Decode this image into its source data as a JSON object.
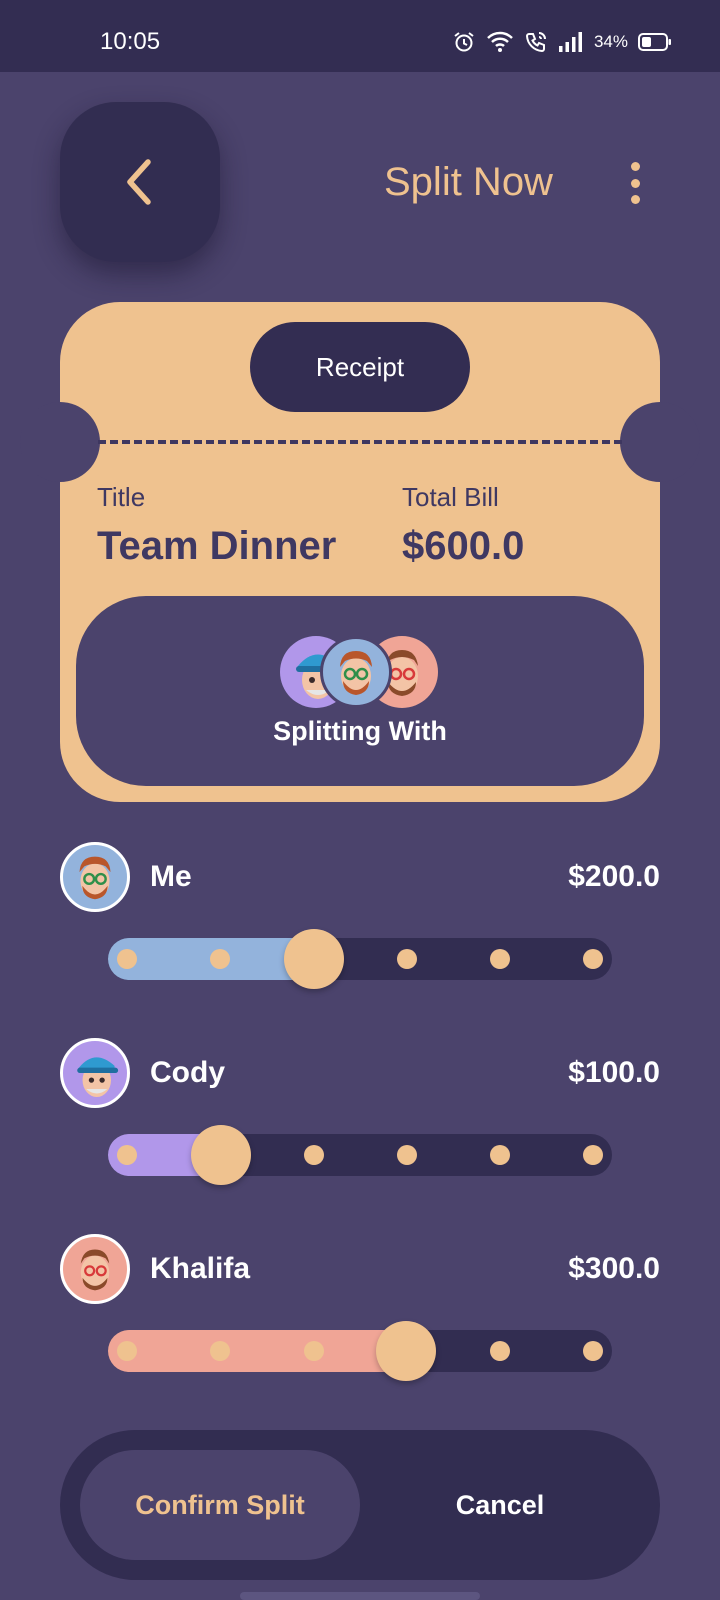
{
  "status_bar": {
    "time": "10:05",
    "battery": "34%",
    "icons": [
      "alarm-icon",
      "wifi-icon",
      "wifi-calling-icon",
      "signal-icon",
      "battery-icon"
    ]
  },
  "header": {
    "title": "Split Now",
    "back_icon": "chevron-left-icon",
    "menu_icon": "more-vertical-icon"
  },
  "receipt": {
    "tab_label": "Receipt",
    "title_label": "Title",
    "title_value": "Team Dinner",
    "total_label": "Total Bill",
    "total_value": "$600.0",
    "splitting_label": "Splitting With"
  },
  "participants": [
    {
      "name": "Me",
      "amount": "$200.0",
      "share_fraction": 0.333,
      "color": "#93b3dc"
    },
    {
      "name": "Cody",
      "amount": "$100.0",
      "share_fraction": 0.167,
      "color": "#b197ea"
    },
    {
      "name": "Khalifa",
      "amount": "$300.0",
      "share_fraction": 0.5,
      "color": "#f0a596"
    }
  ],
  "actions": {
    "confirm_label": "Confirm Split",
    "cancel_label": "Cancel"
  },
  "colors": {
    "background": "#4b436c",
    "dark": "#322d51",
    "accent": "#efc28f"
  }
}
